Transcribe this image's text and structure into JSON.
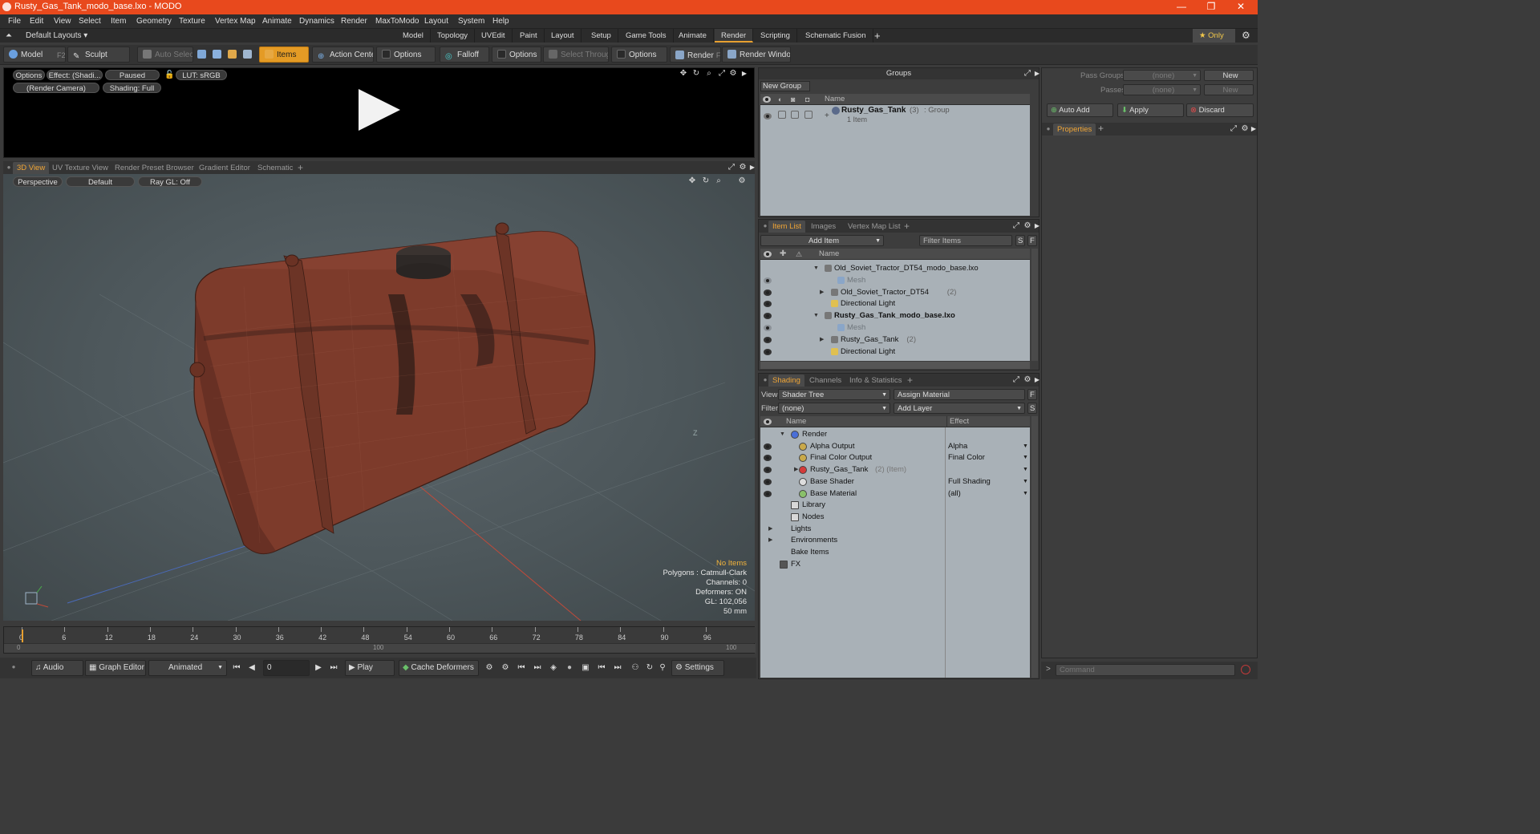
{
  "window": {
    "title": "Rusty_Gas_Tank_modo_base.lxo - MODO",
    "minimize": "—",
    "restore": "❐",
    "close": "✕"
  },
  "menubar": [
    "File",
    "Edit",
    "View",
    "Select",
    "Item",
    "Geometry",
    "Texture",
    "Vertex Map",
    "Animate",
    "Dynamics",
    "Render",
    "MaxToModo",
    "Layout",
    "System",
    "Help"
  ],
  "layout": {
    "preset": "Default Layouts ▾",
    "tabs": [
      "Model",
      "Topology",
      "UVEdit",
      "Paint",
      "Layout",
      "Setup",
      "Game Tools",
      "Animate",
      "Render",
      "Scripting",
      "Schematic Fusion"
    ],
    "active_tab": "Render",
    "add": "+",
    "only_label": "★  Only"
  },
  "toolbar": {
    "model": "Model",
    "model_key": "F2",
    "sculpt": "Sculpt",
    "auto_select": "Auto Select",
    "items": "Items",
    "action_center": "Action Center",
    "options1": "Options",
    "falloff": "Falloff",
    "options2": "Options",
    "select_through": "Select Through",
    "options3": "Options",
    "render": "Render",
    "render_key": "F9",
    "render_window": "Render Window"
  },
  "render_preview": {
    "options": "Options",
    "effect": "Effect: (Shadi...",
    "paused": "Paused",
    "lut": "LUT: sRGB",
    "camera": "(Render Camera)",
    "shading": "Shading: Full"
  },
  "view_tabs": {
    "tabs": [
      "3D View",
      "UV Texture View",
      "Render Preset Browser",
      "Gradient Editor",
      "Schematic"
    ],
    "active": "3D View",
    "add": "+"
  },
  "viewport": {
    "perspective": "Perspective",
    "default": "Default",
    "ray_gl": "Ray GL: Off",
    "axis_label": "Z",
    "info": {
      "no_items": "No Items",
      "polygons": "Polygons : Catmull-Clark",
      "channels": "Channels: 0",
      "deformers": "Deformers: ON",
      "gl": "GL: 102,056",
      "scale": "50 mm"
    }
  },
  "timeline": {
    "ticks": [
      "0",
      "6",
      "12",
      "18",
      "24",
      "30",
      "36",
      "42",
      "48",
      "54",
      "60",
      "66",
      "72",
      "78",
      "84",
      "90",
      "96"
    ],
    "lower_ticks": [
      "0",
      "100",
      "100"
    ]
  },
  "bottom": {
    "audio": "Audio",
    "graph_editor": "Graph Editor",
    "animated": "Animated",
    "frame": "0",
    "play": "Play",
    "cache_deformers": "Cache Deformers",
    "settings": "Settings"
  },
  "groups": {
    "title": "Groups",
    "new_group": "New Group",
    "col_name": "Name",
    "group_name": "Rusty_Gas_Tank",
    "group_count": "(3)",
    "group_type": ": Group",
    "group_sub": "1 Item"
  },
  "passes": {
    "pass_groups_label": "Pass Groups",
    "pass_groups_value": "(none)",
    "passes_label": "Passes",
    "passes_value": "(none)",
    "new1": "New",
    "new2": "New",
    "auto_add": "Auto Add",
    "apply": "Apply",
    "discard": "Discard",
    "properties_tab": "Properties",
    "add": "+"
  },
  "item_list": {
    "tabs": [
      "Item List",
      "Images",
      "Vertex Map List"
    ],
    "active": "Item List",
    "add": "+",
    "add_item": "Add Item",
    "filter": "Filter Items",
    "s": "S",
    "f": "F",
    "col_name": "Name",
    "rows": [
      {
        "label": "Old_Soviet_Tractor_DT54_modo_base.lxo",
        "indent": 0,
        "bold": false,
        "dim": false,
        "expand": "▼",
        "eye": false
      },
      {
        "label": "Mesh",
        "indent": 2,
        "bold": false,
        "dim": true,
        "expand": "",
        "eye": true
      },
      {
        "label": "Old_Soviet_Tractor_DT54",
        "suffix": "(2)",
        "indent": 1,
        "bold": false,
        "dim": false,
        "expand": "▶",
        "eye": true
      },
      {
        "label": "Directional Light",
        "indent": 1,
        "bold": false,
        "dim": false,
        "expand": "",
        "eye": true
      },
      {
        "label": "Rusty_Gas_Tank_modo_base.lxo",
        "indent": 0,
        "bold": true,
        "dim": false,
        "expand": "▼",
        "eye": true
      },
      {
        "label": "Mesh",
        "indent": 2,
        "bold": false,
        "dim": true,
        "expand": "",
        "eye": true
      },
      {
        "label": "Rusty_Gas_Tank",
        "suffix": "(2)",
        "indent": 1,
        "bold": false,
        "dim": false,
        "expand": "▶",
        "eye": true
      },
      {
        "label": "Directional Light",
        "indent": 1,
        "bold": false,
        "dim": false,
        "expand": "",
        "eye": true
      }
    ]
  },
  "shading": {
    "tabs": [
      "Shading",
      "Channels",
      "Info & Statistics"
    ],
    "active": "Shading",
    "add": "+",
    "view_label": "View",
    "view_value": "Shader Tree",
    "assign_material": "Assign Material",
    "f": "F",
    "filter_label": "Filter",
    "filter_value": "(none)",
    "add_layer": "Add Layer",
    "s": "S",
    "col_name": "Name",
    "col_effect": "Effect",
    "rows": [
      {
        "label": "Render",
        "effect": "",
        "indent": 0,
        "expand": "▼",
        "eye": false,
        "icon": "#4a6fd8"
      },
      {
        "label": "Alpha Output",
        "effect": "Alpha",
        "indent": 1,
        "expand": "",
        "eye": true,
        "icon": "#c9a94a"
      },
      {
        "label": "Final Color Output",
        "effect": "Final Color",
        "indent": 1,
        "expand": "",
        "eye": true,
        "icon": "#c9a94a"
      },
      {
        "label": "Rusty_Gas_Tank",
        "suffix": "(2) (Item)",
        "effect": "",
        "indent": 1,
        "expand": "▶",
        "eye": true,
        "icon": "#d43a3a"
      },
      {
        "label": "Base Shader",
        "effect": "Full Shading",
        "indent": 1,
        "expand": "",
        "eye": true,
        "icon": "#dddddd"
      },
      {
        "label": "Base Material",
        "effect": "(all)",
        "indent": 1,
        "expand": "",
        "eye": true,
        "icon": "#8ac06a"
      },
      {
        "label": "Library",
        "effect": "",
        "indent": 0,
        "expand": "",
        "eye": false,
        "icon": "folder"
      },
      {
        "label": "Nodes",
        "effect": "",
        "indent": 0,
        "expand": "",
        "eye": false,
        "icon": "folder"
      },
      {
        "label": "Lights",
        "effect": "",
        "indent": -1,
        "expand": "▶",
        "eye": false,
        "icon": ""
      },
      {
        "label": "Environments",
        "effect": "",
        "indent": -1,
        "expand": "▶",
        "eye": false,
        "icon": ""
      },
      {
        "label": "Bake Items",
        "effect": "",
        "indent": -1,
        "expand": "",
        "eye": false,
        "icon": ""
      },
      {
        "label": "FX",
        "effect": "",
        "indent": -1,
        "expand": "",
        "eye": false,
        "icon": "fx"
      }
    ]
  },
  "command": {
    "placeholder": "Command",
    "prompt": ">"
  }
}
